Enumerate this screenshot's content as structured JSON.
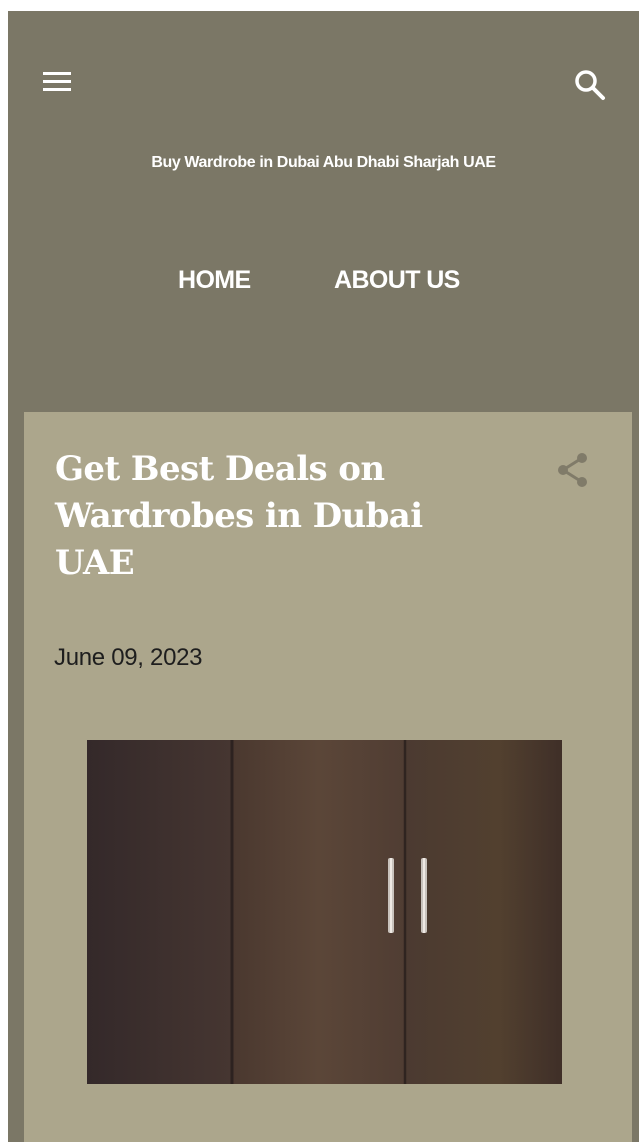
{
  "header": {
    "menu_icon": "hamburger-menu-icon",
    "search_icon": "search-icon",
    "site_title": "Buy Wardrobe in Dubai Abu Dhabi Sharjah UAE"
  },
  "nav": {
    "items": [
      {
        "label": "HOME"
      },
      {
        "label": "ABOUT US"
      }
    ]
  },
  "post": {
    "title": "Get Best Deals on Wardrobes in Dubai UAE",
    "share_icon": "share-icon",
    "date": "June 09, 2023",
    "image_subject": "dark-wood-wardrobe-doors"
  },
  "colors": {
    "header_background": "#7b7766",
    "card_background": "#aca68c",
    "text_light": "#ffffff",
    "text_dark": "#1e1e1e",
    "icon_muted": "#807b69"
  }
}
